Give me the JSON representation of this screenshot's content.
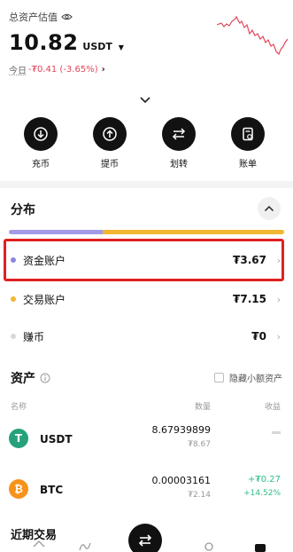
{
  "header": {
    "total_label": "总资产估值",
    "balance_value": "10.82",
    "balance_unit": "USDT",
    "today_label": "今日",
    "today_change": "-₮0.41 (-3.65%)"
  },
  "actions": [
    {
      "label": "充币",
      "icon": "deposit-icon"
    },
    {
      "label": "提币",
      "icon": "withdraw-icon"
    },
    {
      "label": "划转",
      "icon": "transfer-icon"
    },
    {
      "label": "账单",
      "icon": "bill-icon"
    }
  ],
  "distribution": {
    "title": "分布",
    "bar": [
      {
        "name": "资金账户",
        "fraction": 0.34,
        "color": "#a39be8"
      },
      {
        "name": "交易账户",
        "fraction": 0.66,
        "color": "#f2b632"
      }
    ],
    "rows": [
      {
        "name": "资金账户",
        "value": "₮3.67",
        "color": "#8c86e0"
      },
      {
        "name": "交易账户",
        "value": "₮7.15",
        "color": "#f2b632"
      },
      {
        "name": "赚币",
        "value": "₮0",
        "color": "#d8d8d8"
      }
    ]
  },
  "assets": {
    "title": "资产",
    "hide_small_label": "隐藏小额资产",
    "columns": [
      "名称",
      "数量",
      "收益"
    ],
    "rows": [
      {
        "symbol": "USDT",
        "quantity": "8.67939899",
        "fiat": "₮8.67",
        "pnl": "",
        "pnl_pct": "",
        "color": "#26a17b",
        "glyph": "T"
      },
      {
        "symbol": "BTC",
        "quantity": "0.00003161",
        "fiat": "₮2.14",
        "pnl": "+₮0.27",
        "pnl_pct": "+14.52%",
        "color": "#f7931a",
        "glyph": "₿"
      }
    ]
  },
  "recent": {
    "title": "近期交易"
  },
  "colors": {
    "accent": "#111111",
    "negative": "#e0465a",
    "positive": "#2ebd85",
    "highlight": "#e02020"
  }
}
